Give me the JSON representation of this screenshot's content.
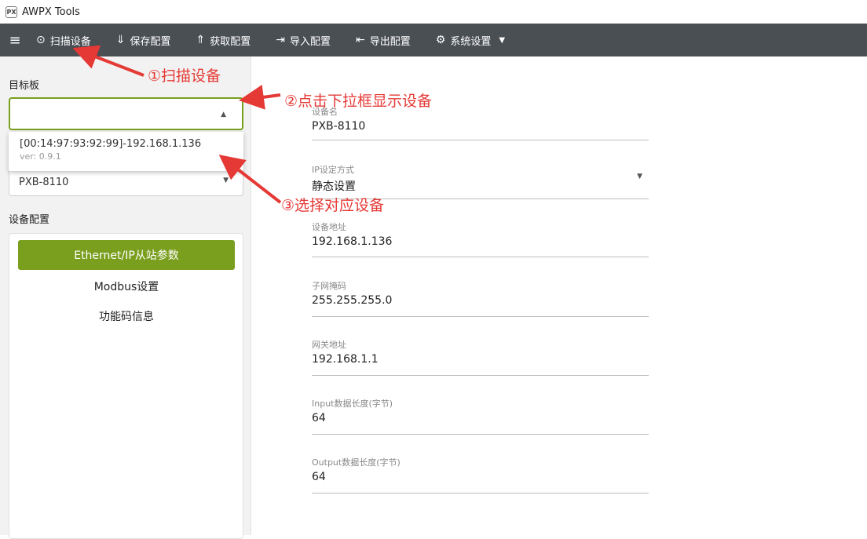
{
  "window": {
    "title": "AWPX Tools",
    "logo_text": "PX"
  },
  "toolbar": {
    "menu_icon": "≡",
    "buttons": [
      {
        "label": "扫描设备",
        "icon": "⊙"
      },
      {
        "label": "保存配置",
        "icon": "⇓"
      },
      {
        "label": "获取配置",
        "icon": "⇑"
      },
      {
        "label": "导入配置",
        "icon": "⇥"
      },
      {
        "label": "导出配置",
        "icon": "⇤"
      },
      {
        "label": "系统设置",
        "icon": "⚙"
      }
    ]
  },
  "left": {
    "target_label": "目标板",
    "select_value": "",
    "dropdown_option": {
      "main": "[00:14:97:93:92:99]-192.168.1.136",
      "sub": "ver: 0.9.1"
    },
    "device_model": "PXB-8110",
    "config_label": "设备配置",
    "nav": [
      "Ethernet/IP从站参数",
      "Modbus设置",
      "功能码信息"
    ]
  },
  "form": {
    "fields": [
      {
        "label": "设备名",
        "value": "PXB-8110"
      },
      {
        "label": "IP设定方式",
        "value": "静态设置"
      },
      {
        "label": "设备地址",
        "value": "192.168.1.136"
      },
      {
        "label": "子网掩码",
        "value": "255.255.255.0"
      },
      {
        "label": "网关地址",
        "value": "192.168.1.1"
      },
      {
        "label": "Input数据长度(字节)",
        "value": "64"
      },
      {
        "label": "Output数据长度(字节)",
        "value": "64"
      }
    ]
  },
  "annotations": {
    "step1": "①扫描设备",
    "step2": "②点击下拉框显示设备",
    "step3": "③选择对应设备",
    "color": "#e53935"
  }
}
